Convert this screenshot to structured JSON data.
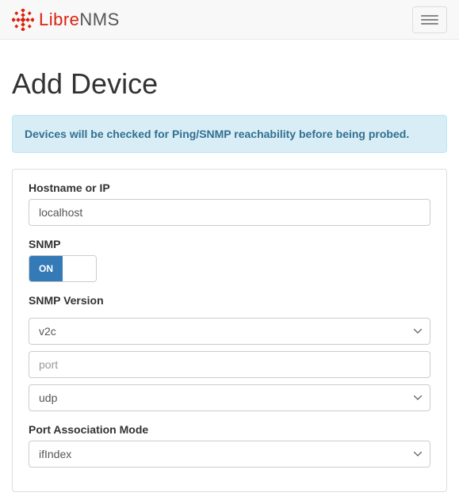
{
  "brand": {
    "first": "Libre",
    "second": "NMS"
  },
  "page": {
    "title": "Add Device",
    "info": "Devices will be checked for Ping/SNMP reachability before being probed."
  },
  "form": {
    "hostname_label": "Hostname or IP",
    "hostname_value": "localhost",
    "snmp_label": "SNMP",
    "snmp_toggle_on": "ON",
    "snmp_version_label": "SNMP Version",
    "snmp_version_value": "v2c",
    "port_placeholder": "port",
    "transport_value": "udp",
    "port_assoc_label": "Port Association Mode",
    "port_assoc_value": "ifIndex"
  }
}
